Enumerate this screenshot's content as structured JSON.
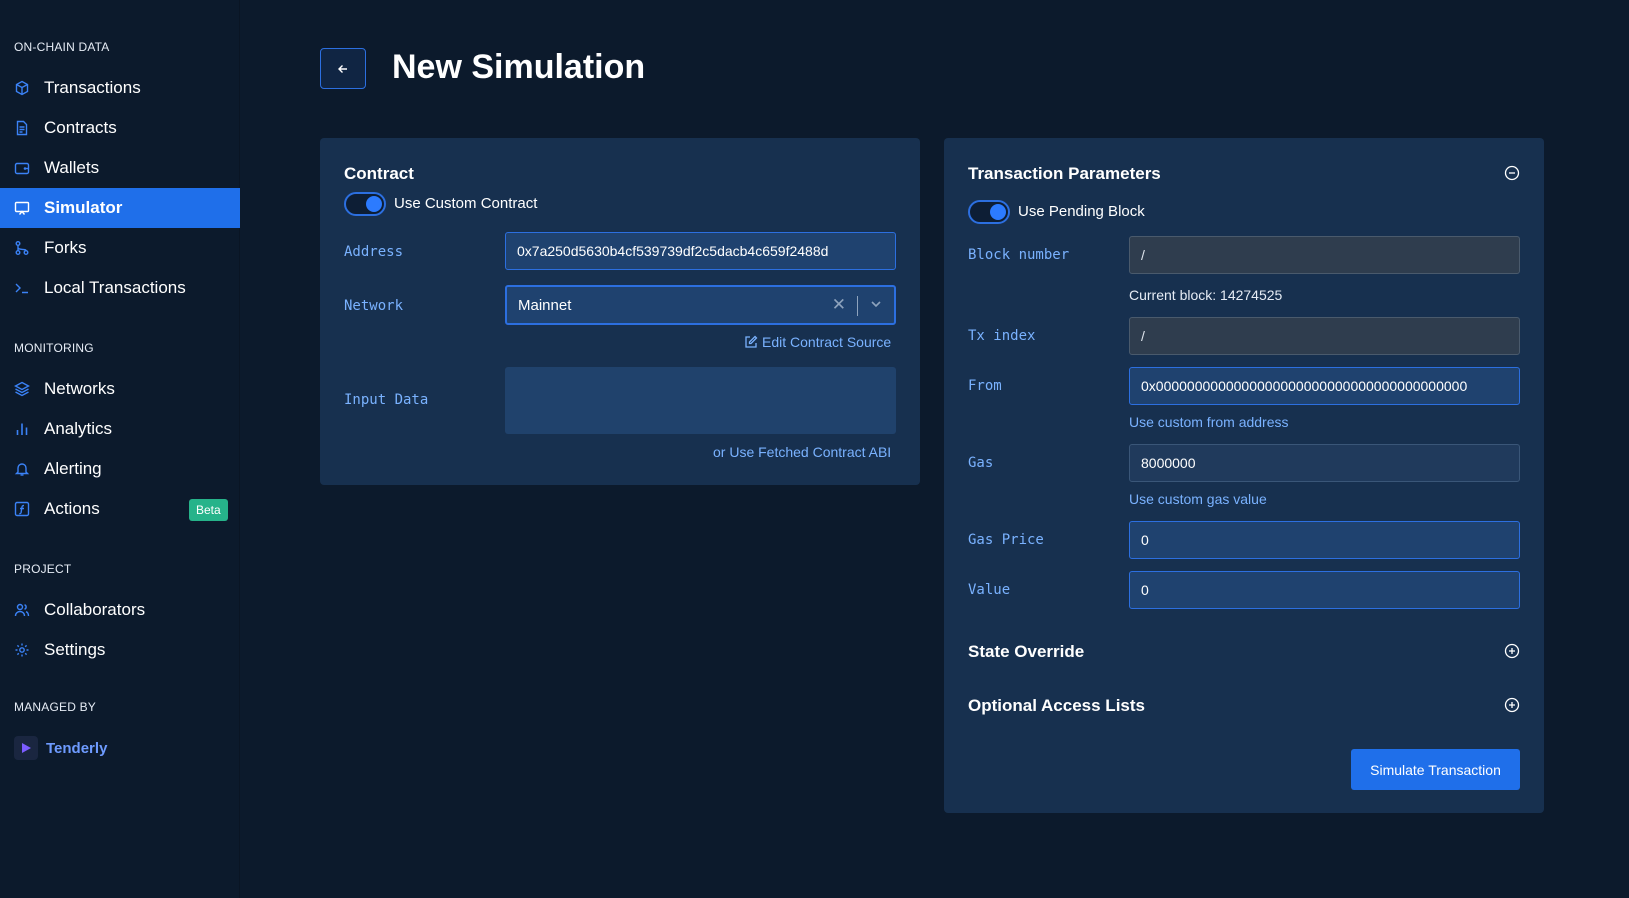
{
  "sidebar": {
    "sections": {
      "onchain": "ON-CHAIN DATA",
      "monitoring": "MONITORING",
      "project": "PROJECT",
      "managed_by": "MANAGED BY"
    },
    "items": [
      {
        "label": "Transactions",
        "icon": "cube-icon"
      },
      {
        "label": "Contracts",
        "icon": "document-icon"
      },
      {
        "label": "Wallets",
        "icon": "wallet-icon"
      },
      {
        "label": "Simulator",
        "icon": "monitor-icon",
        "active": true
      },
      {
        "label": "Forks",
        "icon": "fork-icon"
      },
      {
        "label": "Local Transactions",
        "icon": "terminal-icon"
      },
      {
        "label": "Networks",
        "icon": "layers-icon"
      },
      {
        "label": "Analytics",
        "icon": "bar-chart-icon"
      },
      {
        "label": "Alerting",
        "icon": "bell-icon"
      },
      {
        "label": "Actions",
        "icon": "function-icon",
        "badge": "Beta"
      },
      {
        "label": "Collaborators",
        "icon": "users-icon"
      },
      {
        "label": "Settings",
        "icon": "gear-icon"
      }
    ],
    "brand": "Tenderly"
  },
  "header": {
    "back_icon": "arrow-left-icon",
    "title": "New Simulation"
  },
  "contract": {
    "title": "Contract",
    "toggle_label": "Use Custom Contract",
    "address_label": "Address",
    "address_value": "0x7a250d5630b4cf539739df2c5dacb4c659f2488d",
    "network_label": "Network",
    "network_value": "Mainnet",
    "edit_source": "Edit Contract Source",
    "input_data_label": "Input Data",
    "input_data_value": "",
    "fetched_abi": "or Use Fetched Contract ABI"
  },
  "tx_params": {
    "title": "Transaction Parameters",
    "toggle_label": "Use Pending Block",
    "block_number_label": "Block number",
    "block_number_value": "/",
    "current_block": "Current block: 14274525",
    "tx_index_label": "Tx index",
    "tx_index_value": "/",
    "from_label": "From",
    "from_value": "0x0000000000000000000000000000000000000000",
    "custom_from": "Use custom from address",
    "gas_label": "Gas",
    "gas_value": "8000000",
    "custom_gas": "Use custom gas value",
    "gas_price_label": "Gas Price",
    "gas_price_value": "0",
    "value_label": "Value",
    "value_value": "0",
    "state_override": "State Override",
    "access_lists": "Optional Access Lists",
    "simulate": "Simulate Transaction"
  },
  "colors": {
    "accent": "#1f6fea",
    "background": "#0c1a2c",
    "panel": "#17304f",
    "link": "#7ab2ff",
    "beta": "#26b38a"
  }
}
